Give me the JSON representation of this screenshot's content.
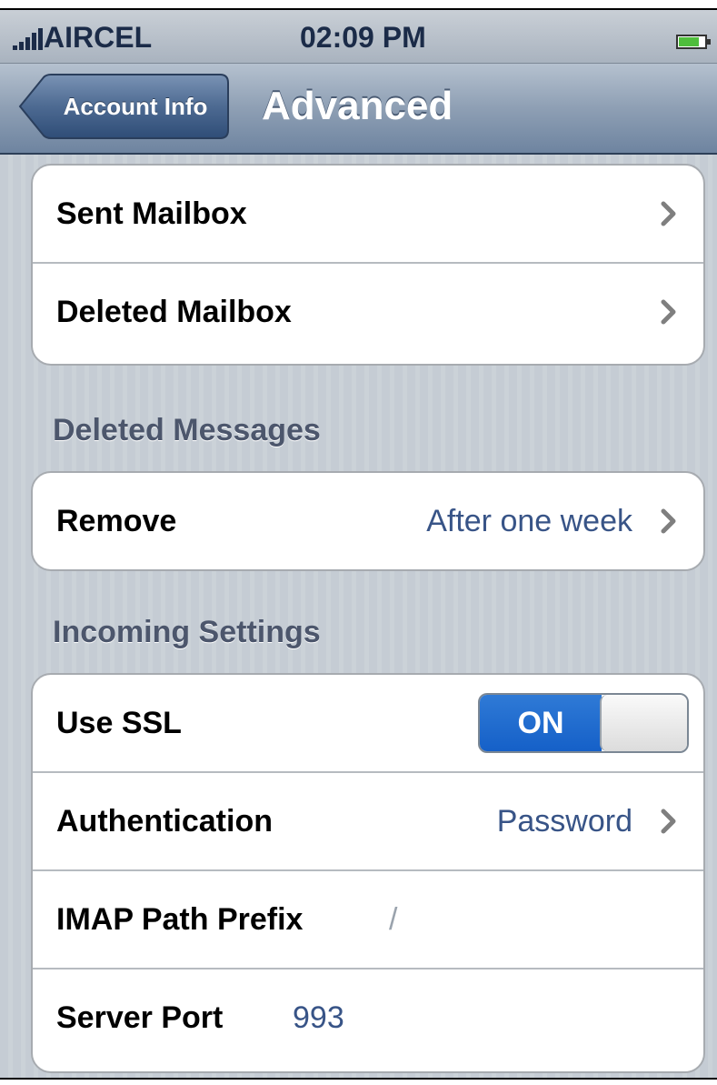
{
  "status_bar": {
    "carrier": "AIRCEL",
    "time": "02:09 PM"
  },
  "nav": {
    "back_label": "Account Info",
    "title": "Advanced"
  },
  "mailbox_group": {
    "items": [
      {
        "label": "Sent Mailbox"
      },
      {
        "label": "Deleted Mailbox"
      }
    ]
  },
  "deleted_messages": {
    "header": "Deleted Messages",
    "remove": {
      "label": "Remove",
      "value": "After one week"
    }
  },
  "incoming_settings": {
    "header": "Incoming Settings",
    "use_ssl": {
      "label": "Use SSL",
      "state": "ON"
    },
    "authentication": {
      "label": "Authentication",
      "value": "Password"
    },
    "imap_path_prefix": {
      "label": "IMAP Path Prefix",
      "value": "/"
    },
    "server_port": {
      "label": "Server Port",
      "value": "993"
    }
  },
  "colors": {
    "value_blue": "#385487",
    "toggle_blue": "#1560c8",
    "nav_bar": "#6e84a0",
    "background": "#c5ccd4"
  }
}
